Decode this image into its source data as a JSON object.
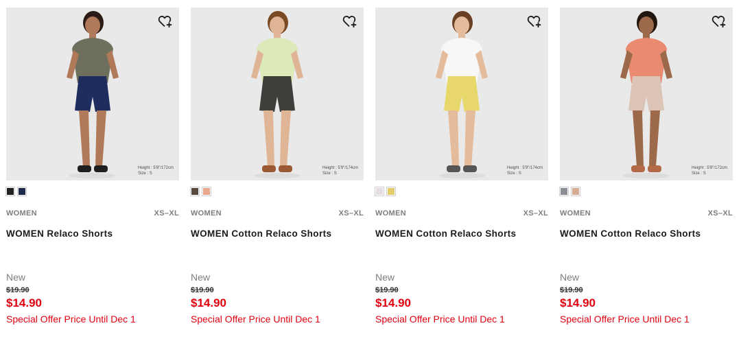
{
  "colors": {
    "sale": "#e0000f",
    "muted": "#7d7d7d",
    "photo_bg": "#e9e9e9"
  },
  "products": [
    {
      "gender": "WOMEN",
      "sizes": "XS–XL",
      "name": "WOMEN Relaco Shorts",
      "flag": "New",
      "original_price": "$19.90",
      "sale_price": "$14.90",
      "promo": "Special Offer Price Until Dec 1",
      "model_height": "Height : 5'8\"/172cm",
      "model_size": "Size : S",
      "favorite_icon": "heart-plus-icon",
      "swatches": [
        "#232323",
        "#1f2a4a"
      ],
      "outfit": {
        "top": "#6e6f5c",
        "bottom": "#1f2d5e",
        "skin": "#b07a5a",
        "hair": "#2b1d16",
        "shoes": "#1f1f1f"
      }
    },
    {
      "gender": "WOMEN",
      "sizes": "XS–XL",
      "name": "WOMEN Cotton Relaco Shorts",
      "flag": "New",
      "original_price": "$19.90",
      "sale_price": "$14.90",
      "promo": "Special Offer Price Until Dec 1",
      "model_height": "Height : 5'9\"/174cm",
      "model_size": "Size : S",
      "favorite_icon": "heart-plus-icon",
      "swatches": [
        "#5a4a3e",
        "#e8a98e"
      ],
      "outfit": {
        "top": "#dbeab8",
        "bottom": "#3d3f3a",
        "skin": "#e0b596",
        "hair": "#7a4a24",
        "shoes": "#9a5a35"
      }
    },
    {
      "gender": "WOMEN",
      "sizes": "XS–XL",
      "name": "WOMEN Cotton Relaco Shorts",
      "flag": "New",
      "original_price": "$19.90",
      "sale_price": "$14.90",
      "promo": "Special Offer Price Until Dec 1",
      "model_height": "Height : 5'9\"/174cm",
      "model_size": "Size : S",
      "favorite_icon": "heart-plus-icon",
      "swatches": [
        "#e6dce4",
        "#e3cc6a"
      ],
      "outfit": {
        "top": "#f7f7f7",
        "bottom": "#e8d76a",
        "skin": "#e4bc9c",
        "hair": "#6a4025",
        "shoes": "#555555"
      }
    },
    {
      "gender": "WOMEN",
      "sizes": "XS–XL",
      "name": "WOMEN Cotton Relaco Shorts",
      "flag": "New",
      "original_price": "$19.90",
      "sale_price": "$14.90",
      "promo": "Special Offer Price Until Dec 1",
      "model_height": "Height : 5'8\"/172cm",
      "model_size": "Size : S",
      "favorite_icon": "heart-plus-icon",
      "swatches": [
        "#8c8e96",
        "#d9ad94"
      ],
      "outfit": {
        "top": "#ea8a70",
        "bottom": "#dcc4b6",
        "skin": "#9c6a4a",
        "hair": "#22170f",
        "shoes": "#b26a48"
      }
    }
  ]
}
